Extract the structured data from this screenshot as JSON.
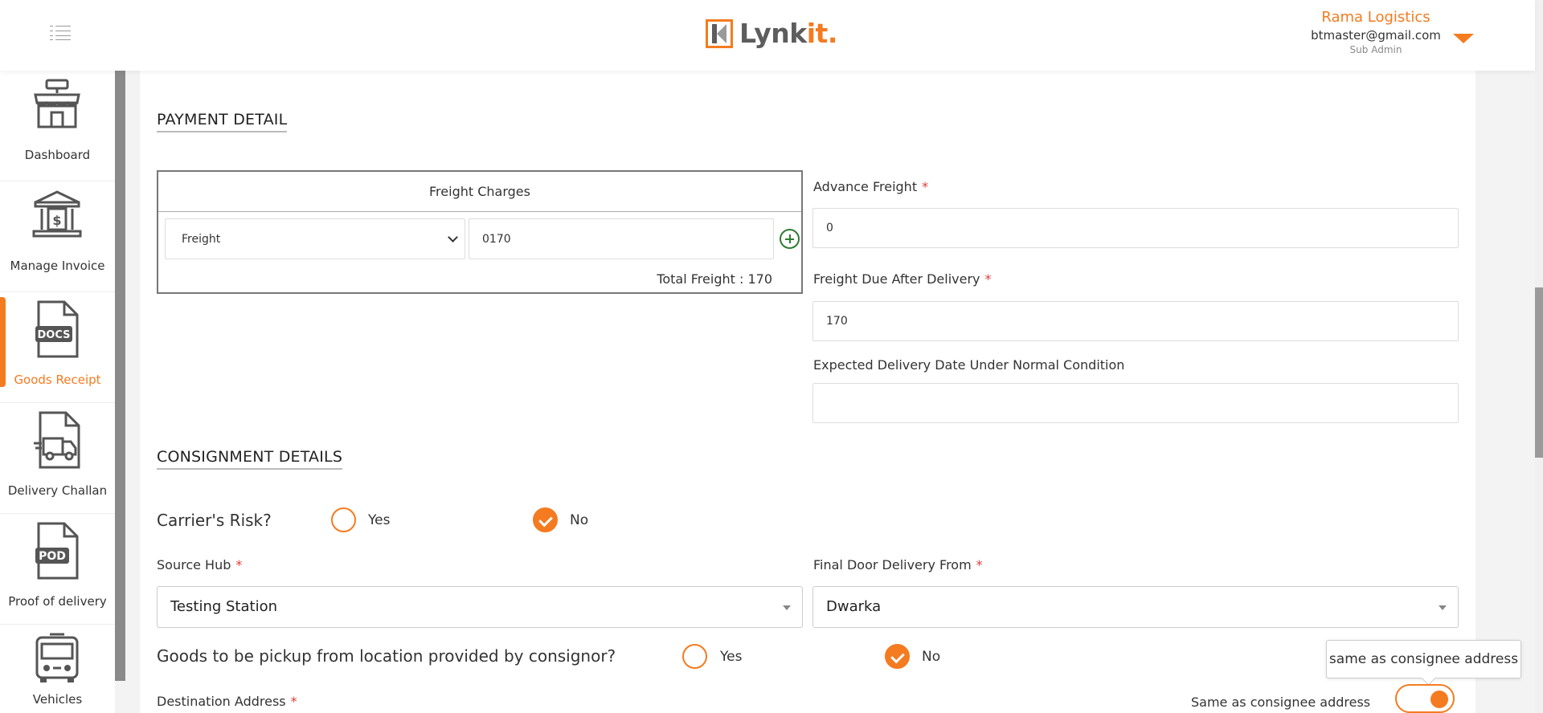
{
  "header": {
    "menu_icon": "list-menu-icon",
    "logo": {
      "text_main": "Lynk",
      "text_accent": "it."
    },
    "user": {
      "company": "Rama Logistics",
      "email": "btmaster@gmail.com",
      "role": "Sub Admin"
    }
  },
  "sidebar": {
    "items": [
      {
        "label": "Dashboard",
        "icon": "store-icon",
        "active": false
      },
      {
        "label": "Manage Invoice",
        "icon": "bank-icon",
        "active": false
      },
      {
        "label": "Goods Receipt",
        "icon": "docs-icon",
        "active": true
      },
      {
        "label": "Delivery Challan",
        "icon": "delivery-truck-icon",
        "active": false
      },
      {
        "label": "Proof of delivery",
        "icon": "pod-icon",
        "active": false
      },
      {
        "label": "Vehicles",
        "icon": "bus-icon",
        "active": false
      }
    ]
  },
  "payment": {
    "title": "PAYMENT DETAIL",
    "freight_header": "Freight Charges",
    "freight_type": "Freight",
    "freight_amount": "0170",
    "total_freight": "Total Freight : 170",
    "advance_label": "Advance Freight",
    "advance_value": "0",
    "due_label": "Freight Due After Delivery",
    "due_value": "170",
    "expected_label": "Expected Delivery Date Under Normal Condition",
    "expected_value": "",
    "required_mark": "*"
  },
  "consignment": {
    "title": "CONSIGNMENT DETAILS",
    "carriers_risk": {
      "question": "Carrier's Risk?",
      "yes": "Yes",
      "no": "No",
      "selected": "No"
    },
    "source_hub": {
      "label": "Source Hub",
      "value": "Testing Station"
    },
    "final_door": {
      "label": "Final Door Delivery From",
      "value": "Dwarka"
    },
    "pickup": {
      "question": "Goods to be pickup from location provided by consignor?",
      "yes": "Yes",
      "no": "No",
      "selected": "No"
    },
    "destination_label": "Destination Address",
    "tooltip": "same as consignee address",
    "toggle_label": "Same as consignee address",
    "toggle_on": true
  },
  "colors": {
    "accent": "#f47b20",
    "required": "#e53935",
    "add_icon": "#2e7d32"
  }
}
